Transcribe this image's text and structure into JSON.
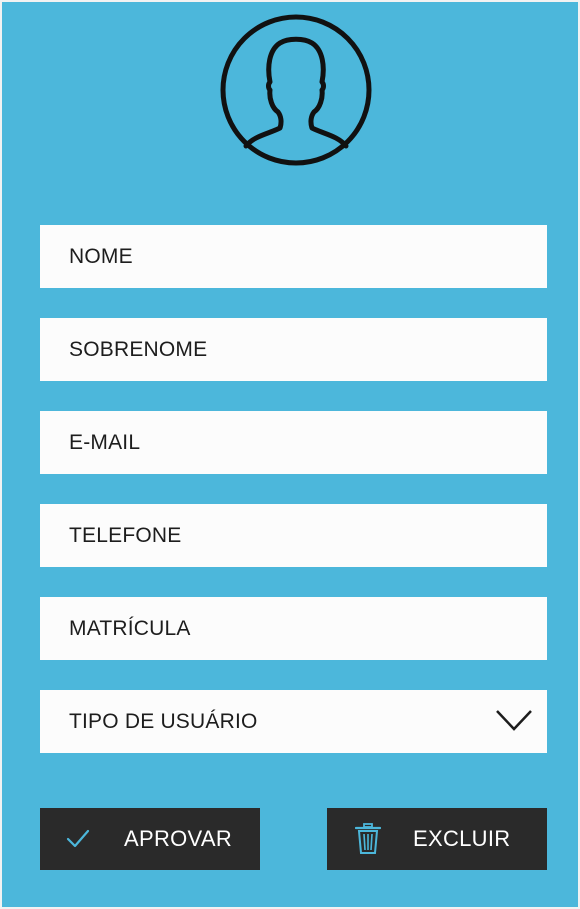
{
  "form": {
    "fields": [
      {
        "label": "NOME"
      },
      {
        "label": "SOBRENOME"
      },
      {
        "label": "E-MAIL"
      },
      {
        "label": "TELEFONE"
      },
      {
        "label": "MATRÍCULA"
      }
    ],
    "user_type": {
      "label": "TIPO DE USUÁRIO",
      "icon": "chevron-down-icon"
    }
  },
  "actions": {
    "approve_label": "APROVAR",
    "approve_icon": "check-icon",
    "delete_label": "EXCLUIR",
    "delete_icon": "trash-icon"
  },
  "avatar": {
    "icon": "user-avatar-icon"
  },
  "colors": {
    "background": "#4cb7db",
    "field": "#fcfcfc",
    "button": "#2a2a2a",
    "accent": "#4cb7db"
  }
}
